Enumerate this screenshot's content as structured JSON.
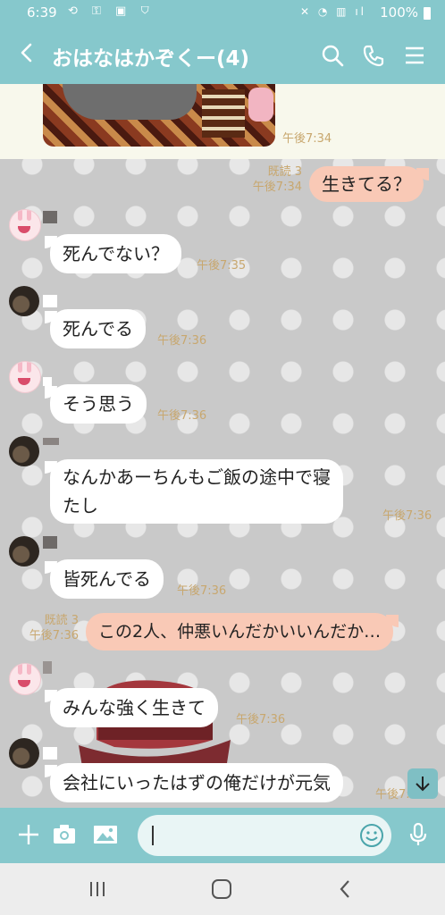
{
  "status_bar": {
    "time": "6:39",
    "battery": "100%"
  },
  "header": {
    "title": "おはなはかぞくー(4)"
  },
  "messages": {
    "m0": {
      "time": "午後7:34"
    },
    "m1": {
      "read": "既読 3",
      "time": "午後7:34",
      "text": "生きてる？"
    },
    "m2": {
      "text": "死んでない？",
      "time": "午後7:35"
    },
    "m3": {
      "text": "死んでる",
      "time": "午後7:36"
    },
    "m4": {
      "text": "そう思う",
      "time": "午後7:36"
    },
    "m5": {
      "line1": "なんかあーちんもご飯の途中で寝",
      "line2": "たし",
      "time": "午後7:36"
    },
    "m6": {
      "text": "皆死んでる",
      "time": "午後7:36"
    },
    "m7": {
      "read": "既読 3",
      "time": "午後7:36",
      "text": "この2人、仲悪いんだかいいんだか…"
    },
    "m8": {
      "text": "みんな強く生きて",
      "time": "午後7:36"
    },
    "m9": {
      "text": "会社にいったはずの俺だけが元気",
      "time": "午後7:"
    }
  },
  "icons": {
    "back": "chevron-left-icon",
    "search": "search-icon",
    "call": "phone-icon",
    "menu": "menu-icon",
    "plus": "plus-icon",
    "camera": "camera-icon",
    "image": "image-icon",
    "emoji": "emoji-icon",
    "mic": "mic-icon",
    "scroll_down": "arrow-down-icon"
  },
  "colors": {
    "header_bg": "#86c8cc",
    "out_bubble": "#f9c9b6",
    "in_bubble": "#ffffff",
    "timestamp": "#c8a76e"
  }
}
